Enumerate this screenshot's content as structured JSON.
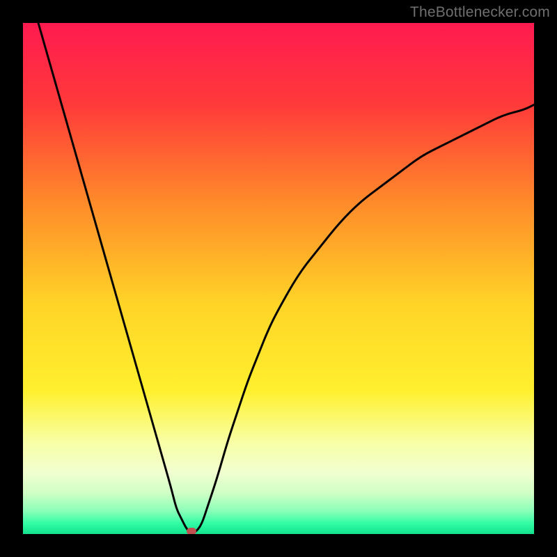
{
  "watermark": {
    "text": "TheBottlenecker.com"
  },
  "chart_data": {
    "type": "line",
    "title": "",
    "xlabel": "",
    "ylabel": "",
    "xlim": [
      0,
      100
    ],
    "ylim": [
      0,
      100
    ],
    "x": [
      3,
      5,
      7,
      9,
      11,
      13,
      15,
      17,
      19,
      21,
      23,
      25,
      27,
      29,
      30,
      31,
      32,
      33,
      34,
      35,
      36,
      38,
      40,
      42,
      44,
      46,
      48,
      50,
      54,
      58,
      62,
      66,
      70,
      74,
      78,
      82,
      86,
      90,
      94,
      98,
      100
    ],
    "values": [
      100,
      93,
      86,
      79,
      72,
      65,
      58,
      51,
      44,
      37,
      30,
      23,
      16,
      9,
      5,
      3,
      1,
      0,
      0.6,
      2,
      5,
      11,
      18,
      24,
      30,
      35,
      40,
      44,
      51,
      56,
      61,
      65,
      68,
      71,
      74,
      76,
      78,
      80,
      82,
      83,
      84
    ],
    "minimum_marker": {
      "x": 33,
      "y": 0
    },
    "gradient_stops": [
      {
        "pct": 0,
        "color": "#ff1a4f"
      },
      {
        "pct": 16,
        "color": "#ff3a3a"
      },
      {
        "pct": 35,
        "color": "#ff8a2a"
      },
      {
        "pct": 55,
        "color": "#ffd427"
      },
      {
        "pct": 72,
        "color": "#fff02e"
      },
      {
        "pct": 82,
        "color": "#f8ffa5"
      },
      {
        "pct": 88,
        "color": "#f1ffd0"
      },
      {
        "pct": 92,
        "color": "#cfffc4"
      },
      {
        "pct": 95.5,
        "color": "#8affb9"
      },
      {
        "pct": 98,
        "color": "#2ffca3"
      },
      {
        "pct": 100,
        "color": "#13e28e"
      }
    ]
  }
}
